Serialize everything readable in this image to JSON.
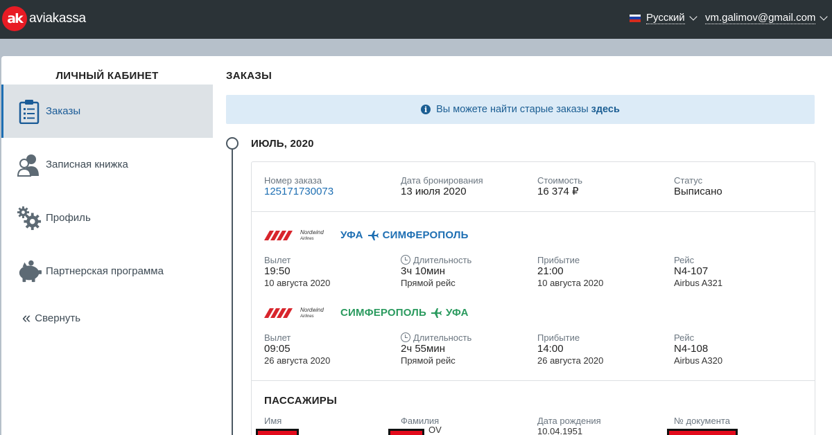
{
  "header": {
    "logo_mark": "ak",
    "logo_text": "aviakassa",
    "language": "Русский",
    "user_email": "vm.galimov@gmail.com"
  },
  "sidebar": {
    "title": "ЛИЧНЫЙ КАБИНЕТ",
    "items": [
      {
        "label": "Заказы",
        "icon": "clipboard-icon",
        "active": true
      },
      {
        "label": "Записная книжка",
        "icon": "contacts-icon",
        "active": false
      },
      {
        "label": "Профиль",
        "icon": "gears-icon",
        "active": false
      },
      {
        "label": "Партнерская программа",
        "icon": "piggy-bank-icon",
        "active": false
      }
    ],
    "collapse_label": "Свернуть"
  },
  "main": {
    "title": "ЗАКАЗЫ",
    "notice_text": "Вы можете найти старые заказы",
    "notice_link": "здесь",
    "month": "ИЮЛЬ, 2020"
  },
  "order": {
    "number_label": "Номер заказа",
    "number": "125171730073",
    "booking_date_label": "Дата бронирования",
    "booking_date": "13 июля 2020",
    "price_label": "Стоимость",
    "price": "16 374 ₽",
    "status_label": "Статус",
    "status": "Выписано"
  },
  "flights": [
    {
      "airline": "Nordwind",
      "airline_sub": "Airlines",
      "from": "УФА",
      "to": "СИМФЕРОПОЛЬ",
      "direction_color": "#1e6fb3",
      "departure_label": "Вылет",
      "departure_time": "19:50",
      "departure_date": "10 августа 2020",
      "duration_label": "Длительность",
      "duration": "3ч 10мин",
      "flight_type": "Прямой рейс",
      "arrival_label": "Прибытие",
      "arrival_time": "21:00",
      "arrival_date": "10 августа 2020",
      "flight_label": "Рейс",
      "flight_number": "N4-107",
      "aircraft": "Airbus A321"
    },
    {
      "airline": "Nordwind",
      "airline_sub": "Airlines",
      "from": "СИМФЕРОПОЛЬ",
      "to": "УФА",
      "direction_color": "#2a9a5e",
      "departure_label": "Вылет",
      "departure_time": "09:05",
      "departure_date": "26 августа 2020",
      "duration_label": "Длительность",
      "duration": "2ч 55мин",
      "flight_type": "Прямой рейс",
      "arrival_label": "Прибытие",
      "arrival_time": "14:00",
      "arrival_date": "26 августа 2020",
      "flight_label": "Рейс",
      "flight_number": "N4-108",
      "aircraft": "Airbus A320"
    }
  ],
  "passengers": {
    "title": "ПАССАЖИРЫ",
    "name_label": "Имя",
    "surname_label": "Фамилия",
    "surname_visible_tail": "OV",
    "birth_label": "Дата рождения",
    "birth_date": "10.04.1951",
    "document_label": "№ документа"
  },
  "colors": {
    "header_bg": "#2b3337",
    "brand_red": "#e81b24",
    "link_blue": "#1e6fb3",
    "route_green": "#2a9a5e",
    "notice_bg": "#dcebf7"
  }
}
